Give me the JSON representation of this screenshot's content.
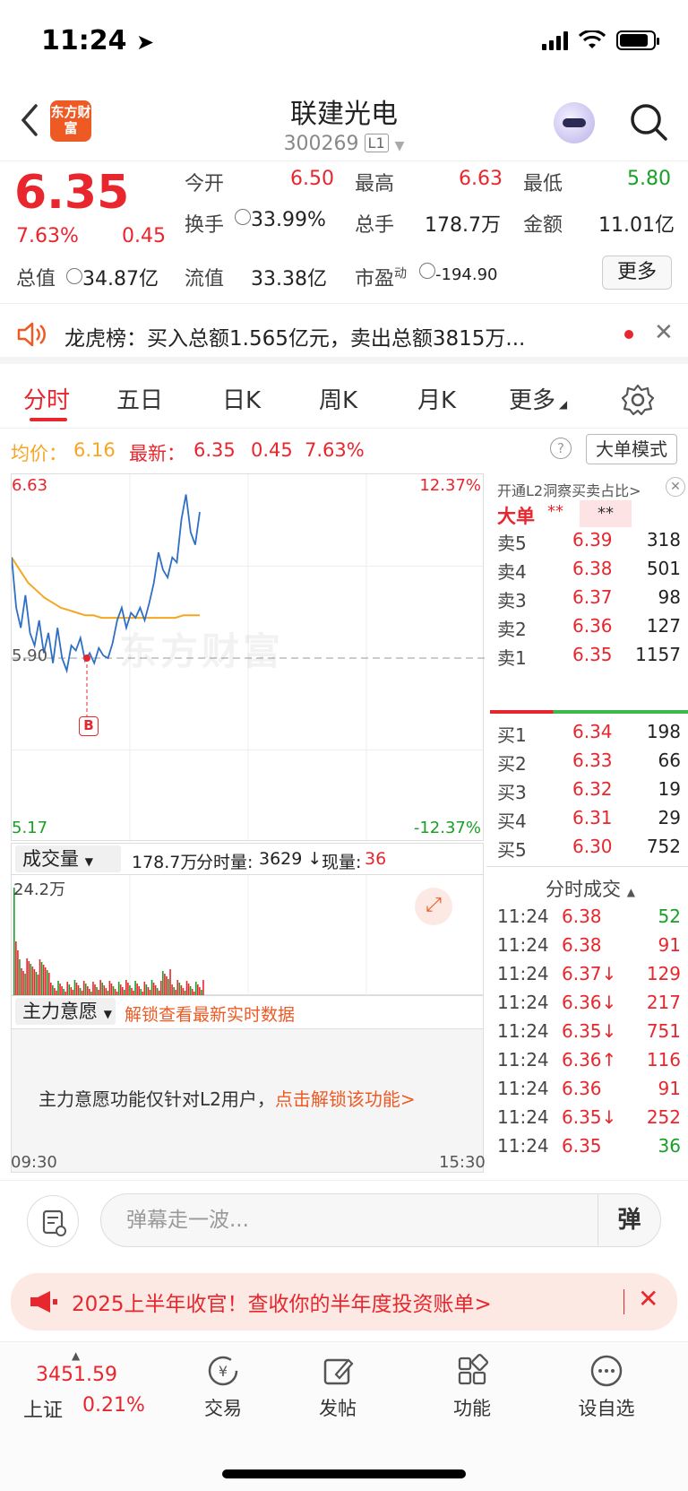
{
  "status": {
    "time": "11:24"
  },
  "header": {
    "logo": "东方财富",
    "name": "联建光电",
    "code": "300269",
    "level": "L1"
  },
  "quote": {
    "price": "6.35",
    "pct": "7.63%",
    "change": "0.45",
    "open_label": "今开",
    "open": "6.50",
    "high_label": "最高",
    "high": "6.63",
    "low_label": "最低",
    "low": "5.80",
    "turnover_label": "换手",
    "turnover": "33.99%",
    "vol_label": "总手",
    "vol": "178.7万",
    "amount_label": "金额",
    "amount": "11.01亿",
    "mcap_label": "总值",
    "mcap": "34.87亿",
    "float_label": "流值",
    "float": "33.38亿",
    "pe_label": "市盈",
    "pe_sup": "动",
    "pe": "-194.90",
    "more": "更多"
  },
  "banner": {
    "text": "龙虎榜：买入总额1.565亿元，卖出总额3815万..."
  },
  "tabs": [
    "分时",
    "五日",
    "日K",
    "周K",
    "月K",
    "更多"
  ],
  "infoline": {
    "avg_label": "均价：",
    "avg": "6.16",
    "latest_label": "最新：",
    "latest": "6.35",
    "chg": "0.45",
    "pct": "7.63%",
    "mode_btn": "大单模式"
  },
  "chart_data": {
    "type": "line",
    "ylim": [
      5.17,
      6.63
    ],
    "y_top_label": "6.63",
    "y_bottom_label": "5.17",
    "pct_top_label": "12.37%",
    "pct_bottom_label": "-12.37%",
    "ref_label": "5.90",
    "ref_value": 5.9,
    "x_start_label": "09:30",
    "x_end_label": "15:30",
    "buy_marker": "B",
    "price_series": [
      6.3,
      6.1,
      6.02,
      6.15,
      6.0,
      5.95,
      6.05,
      5.92,
      6.0,
      5.88,
      6.02,
      5.9,
      5.85,
      5.95,
      5.93,
      5.98,
      5.89,
      5.92,
      5.88,
      5.94,
      5.91,
      5.9,
      5.96,
      6.05,
      6.1,
      6.02,
      6.08,
      6.06,
      6.1,
      6.05,
      6.12,
      6.2,
      6.32,
      6.25,
      6.22,
      6.3,
      6.28,
      6.45,
      6.55,
      6.4,
      6.35,
      6.48
    ],
    "avg_series": [
      6.3,
      6.25,
      6.2,
      6.17,
      6.14,
      6.12,
      6.1,
      6.09,
      6.08,
      6.07,
      6.07,
      6.06,
      6.06,
      6.06,
      6.06,
      6.06,
      6.06,
      6.06,
      6.06,
      6.06,
      6.06,
      6.07,
      6.07,
      6.07
    ]
  },
  "volume": {
    "selector": "成交量",
    "total": "178.7万",
    "tick_label": "分时量:",
    "tick": "3629",
    "cur_label": "现量:",
    "cur": "36",
    "max_label": "24.2万"
  },
  "main_intent": {
    "selector": "主力意愿",
    "unlock": "解锁查看最新实时数据",
    "msg": "主力意愿功能仅针对L2用户，",
    "link": "点击解锁该功能>"
  },
  "orderbook": {
    "promo": "开通L2洞察买卖占比>",
    "big_label": "大单",
    "big_a": "**",
    "big_b": "**",
    "sell": [
      {
        "label": "卖5",
        "price": "6.39",
        "vol": "318"
      },
      {
        "label": "卖4",
        "price": "6.38",
        "vol": "501"
      },
      {
        "label": "卖3",
        "price": "6.37",
        "vol": "98"
      },
      {
        "label": "卖2",
        "price": "6.36",
        "vol": "127"
      },
      {
        "label": "卖1",
        "price": "6.35",
        "vol": "1157"
      }
    ],
    "buy": [
      {
        "label": "买1",
        "price": "6.34",
        "vol": "198"
      },
      {
        "label": "买2",
        "price": "6.33",
        "vol": "66"
      },
      {
        "label": "买3",
        "price": "6.32",
        "vol": "19"
      },
      {
        "label": "买4",
        "price": "6.31",
        "vol": "29"
      },
      {
        "label": "买5",
        "price": "6.30",
        "vol": "752"
      }
    ]
  },
  "ticks": {
    "title": "分时成交",
    "rows": [
      {
        "time": "11:24",
        "price": "6.38",
        "vol": "52",
        "dir": ""
      },
      {
        "time": "11:24",
        "price": "6.38",
        "vol": "91",
        "dir": ""
      },
      {
        "time": "11:24",
        "price": "6.37↓",
        "vol": "129",
        "dir": "down"
      },
      {
        "time": "11:24",
        "price": "6.36↓",
        "vol": "217",
        "dir": "down"
      },
      {
        "time": "11:24",
        "price": "6.35↓",
        "vol": "751",
        "dir": "down"
      },
      {
        "time": "11:24",
        "price": "6.36↑",
        "vol": "116",
        "dir": "up"
      },
      {
        "time": "11:24",
        "price": "6.36",
        "vol": "91",
        "dir": ""
      },
      {
        "time": "11:24",
        "price": "6.35↓",
        "vol": "252",
        "dir": "down"
      },
      {
        "time": "11:24",
        "price": "6.35",
        "vol": "36",
        "dir": ""
      }
    ]
  },
  "danmu": {
    "placeholder": "弹幕走一波...",
    "send": "弹"
  },
  "promo": {
    "text": "2025上半年收官！查收你的半年度投资账单>"
  },
  "bottom_nav": {
    "index_value": "3451.59",
    "index_name": "上证",
    "index_pct": "0.21%",
    "items": [
      "交易",
      "发帖",
      "功能",
      "设自选"
    ]
  },
  "colors": {
    "up": "#e8262d",
    "down": "#18a027",
    "avg": "#f5a623",
    "price_line": "#2f6fc4"
  }
}
